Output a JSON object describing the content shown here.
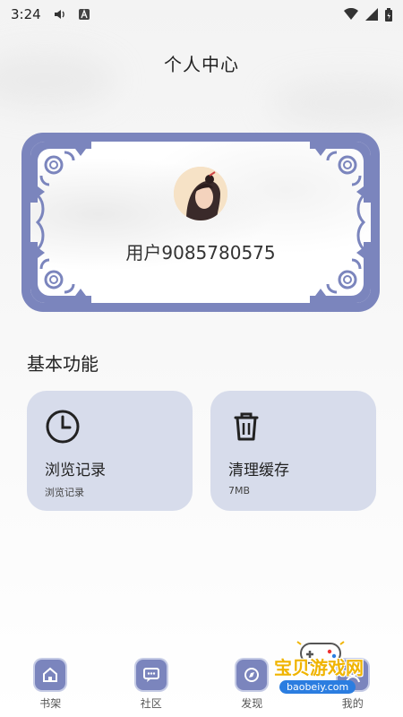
{
  "status_bar": {
    "time": "3:24",
    "icons": [
      "volume-icon",
      "a-badge-icon",
      "wifi-icon",
      "signal-icon",
      "battery-icon"
    ]
  },
  "page": {
    "title": "个人中心"
  },
  "profile": {
    "username": "用户9085780575",
    "frame_color": "#7b85bd"
  },
  "features": {
    "section_title": "基本功能",
    "items": [
      {
        "title": "浏览记录",
        "subtitle": "浏览记录",
        "icon": "clock-icon"
      },
      {
        "title": "清理缓存",
        "subtitle": "7MB",
        "icon": "trash-icon"
      }
    ],
    "card_color": "#d7dceb"
  },
  "bottom_nav": {
    "items": [
      {
        "label": "书架",
        "icon": "bookshelf-icon"
      },
      {
        "label": "社区",
        "icon": "chat-icon"
      },
      {
        "label": "发现",
        "icon": "discover-icon"
      },
      {
        "label": "我的",
        "icon": "profile-icon"
      }
    ]
  },
  "watermark": {
    "brand": "宝贝游戏网",
    "url": "baobeiy.com"
  }
}
